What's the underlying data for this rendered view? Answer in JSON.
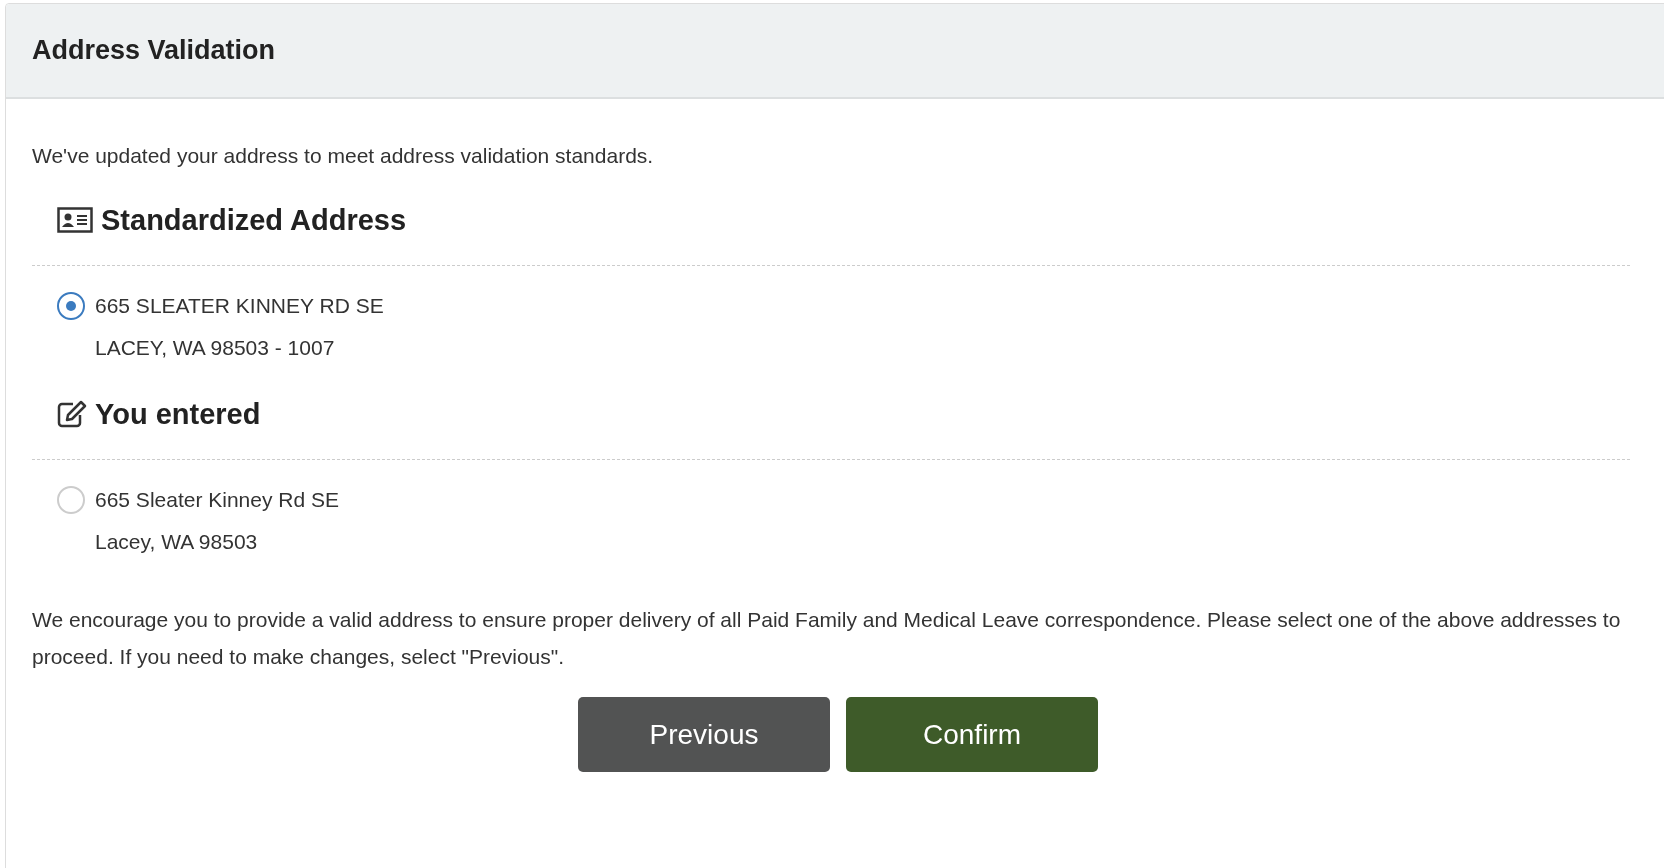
{
  "panel": {
    "title": "Address Validation"
  },
  "intro": "We've updated your address to meet address validation standards.",
  "sections": [
    {
      "kind": "standardized",
      "heading": "Standardized Address",
      "option": {
        "selected": true,
        "lines": [
          "665 SLEATER KINNEY RD SE",
          "LACEY, WA 98503 - 1007"
        ]
      }
    },
    {
      "kind": "entered",
      "heading": "You entered",
      "option": {
        "selected": false,
        "lines": [
          "665 Sleater Kinney Rd SE",
          "Lacey, WA 98503"
        ]
      }
    }
  ],
  "notice": "We encourage you to provide a valid address to ensure proper delivery of all Paid Family and Medical Leave correspondence. Please select one of the above addresses to proceed. If you need to make changes, select \"Previous\".",
  "buttons": [
    {
      "kind": "secondary",
      "label": "Previous"
    },
    {
      "kind": "primary",
      "label": "Confirm"
    }
  ]
}
